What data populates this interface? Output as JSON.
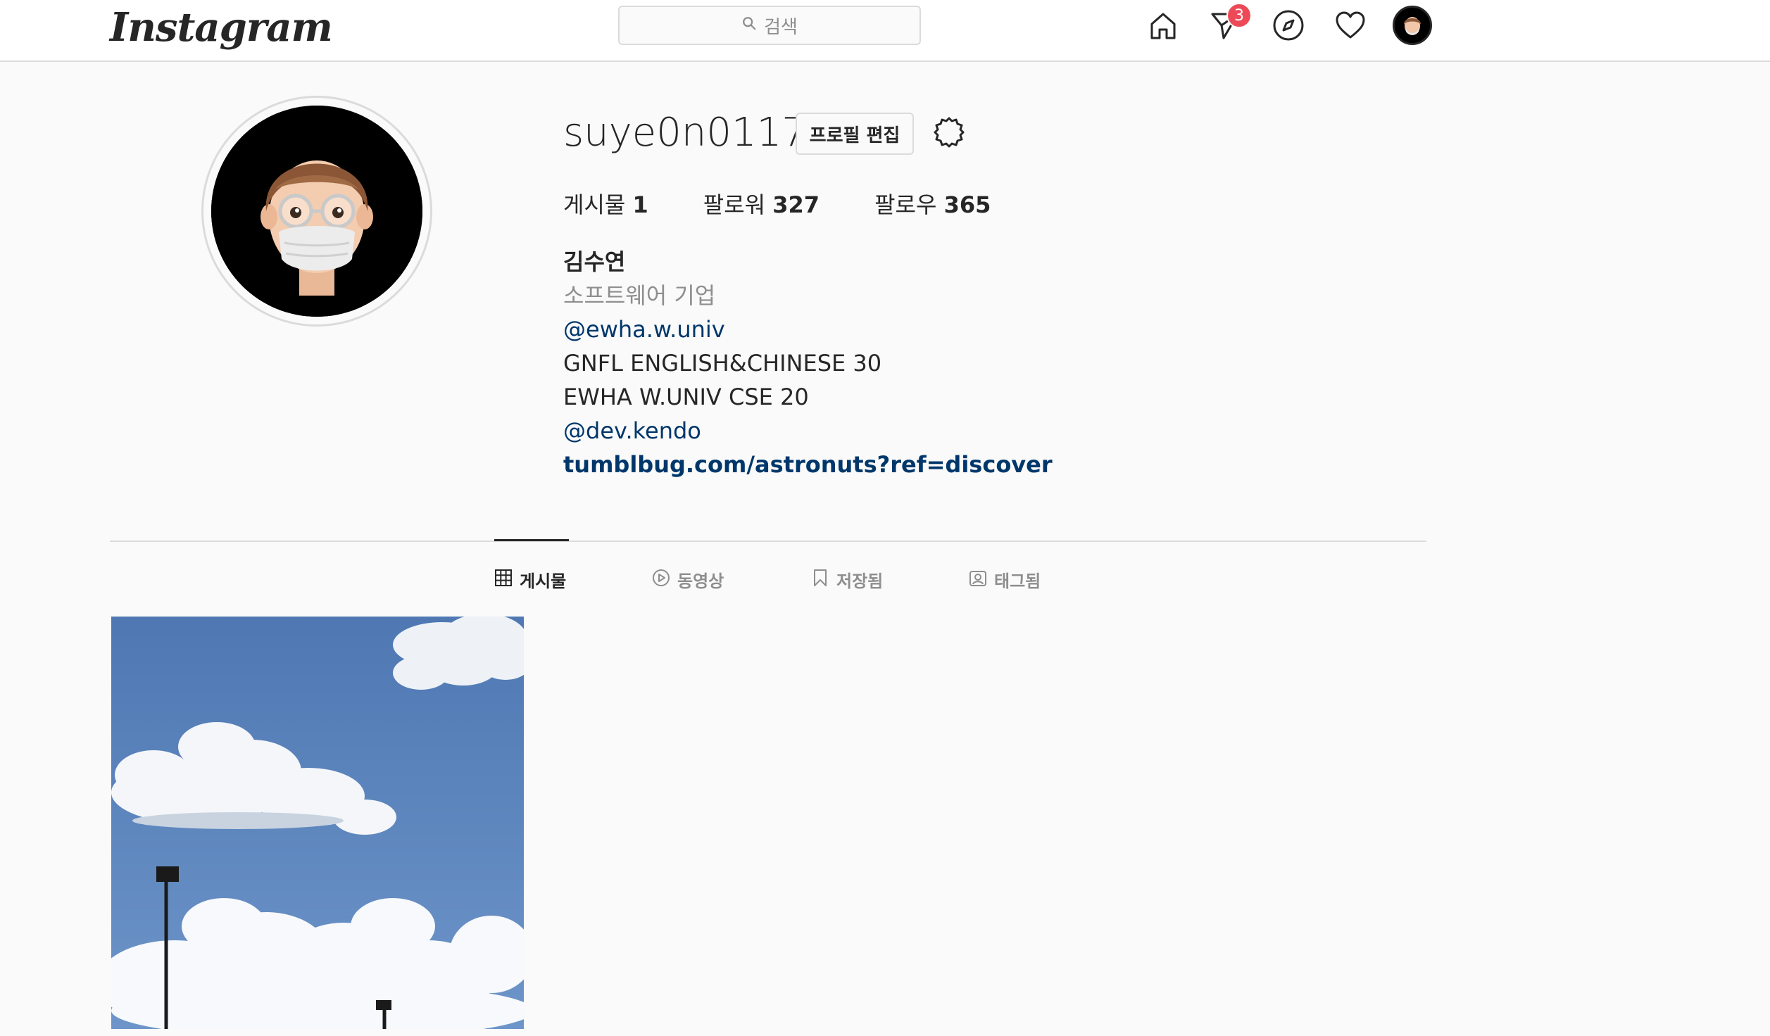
{
  "nav": {
    "logo": "Instagram",
    "search_placeholder": "검색",
    "direct_badge": "3",
    "icons": [
      "home-icon",
      "direct-icon",
      "explore-icon",
      "activity-heart-icon",
      "profile-avatar"
    ]
  },
  "profile": {
    "username": "suye0n0117",
    "edit_label": "프로필 편집",
    "stats": [
      {
        "label": "게시물",
        "value": "1"
      },
      {
        "label": "팔로워",
        "value": "327"
      },
      {
        "label": "팔로우",
        "value": "365"
      }
    ],
    "name": "김수연",
    "category": "소프트웨어 기업",
    "bio_mention_1": "@ewha.w.univ",
    "bio_line_1": "GNFL ENGLISH&CHINESE 30",
    "bio_line_2": "EWHA W.UNIV CSE 20",
    "bio_mention_2": "@dev.kendo",
    "website": "tumblbug.com/astronuts?ref=discover"
  },
  "tabs": [
    {
      "label": "게시물",
      "icon": "grid-icon",
      "active": true
    },
    {
      "label": "동영상",
      "icon": "video-play-icon",
      "active": false
    },
    {
      "label": "저장됨",
      "icon": "bookmark-icon",
      "active": false
    },
    {
      "label": "태그됨",
      "icon": "tagged-user-icon",
      "active": false
    }
  ],
  "colors": {
    "badge": "#ed4956",
    "link": "#00376b",
    "muted": "#8e8e8e",
    "text": "#262626"
  }
}
